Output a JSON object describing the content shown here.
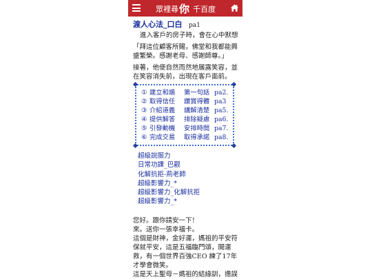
{
  "header": {
    "brand_left": "眾裡尋",
    "brand_you": "你",
    "brand_right": "千百度"
  },
  "article": {
    "title": "渡人心法_口白",
    "page_ref": "pa1",
    "intro": "進入客戶的房子時，會在心中默想",
    "quote": "「拜這位顧客所賜，佛堂和我都能興盛繁榮。感謝老母、感謝師尊。」",
    "after": "接著，他便自然而然地展露笑容，並在笑容消失前，出現在客戶面前。"
  },
  "toc": [
    {
      "num": "①",
      "left": "建立和諧",
      "right": "第一句話",
      "page": "pa2."
    },
    {
      "num": "②",
      "left": "取得信任",
      "right": "讚賞得體",
      "page": "pa3"
    },
    {
      "num": "③",
      "left": "介紹道義",
      "right": "講解清楚",
      "page": "pa5."
    },
    {
      "num": "④",
      "left": "提供解答",
      "right": "排除疑慮",
      "page": "pa6."
    },
    {
      "num": "⑤",
      "left": "引發動機",
      "right": "安排時間",
      "page": "pa7."
    },
    {
      "num": "⑥",
      "left": "完成交易",
      "right": "取得承諾",
      "page": "pa8."
    }
  ],
  "links": [
    "超級說服力",
    "日常功課_巴觀",
    "化解抗拒-荊老師",
    "超級影響力_*",
    "超級影響力_化解抗拒",
    "超級影響力_*"
  ],
  "story": [
    "您好。跟你請安一下！",
    "來。送你一張幸福卡。",
    "這個是財神，金好運，媽祖的平安符保就平安，這是五福臨門頌，開運救，有一個世界百強CEO 練了17年才學會微笑。",
    "這是天上聖母－媽祖的結緣訓，擔誤一分鐘，簽耳壓你介紹一下，有四個"
  ]
}
